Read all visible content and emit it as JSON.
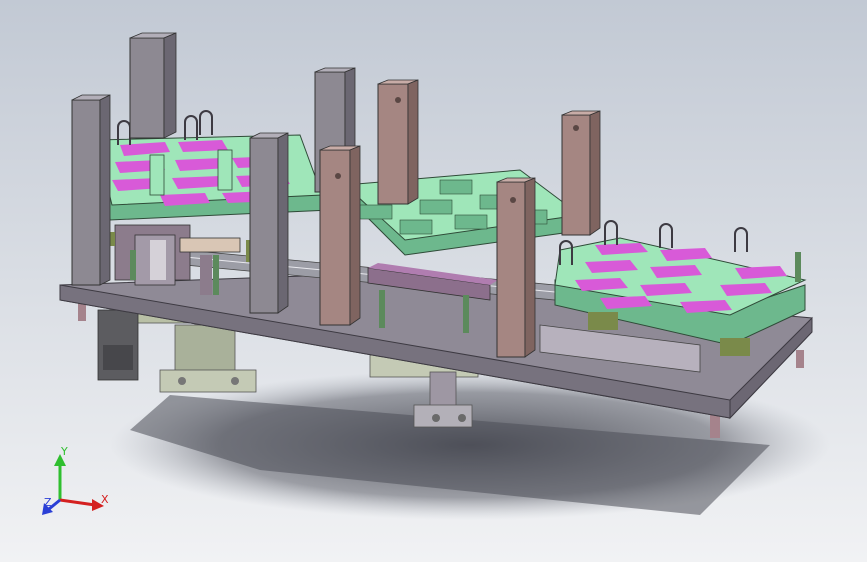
{
  "viewport": {
    "background_top": "#c2c9d4",
    "background_bottom": "#f1f2f4"
  },
  "model": {
    "colors": {
      "plate": "#8f8a96",
      "plate_dark": "#6f6a76",
      "post": "#a58682",
      "post_dark": "#7f6460",
      "post_gray": "#8d8992",
      "green": "#9fe6b9",
      "green_dark": "#6db88d",
      "magenta": "#d85ad8",
      "magenta_dark": "#a43aa8",
      "olive": "#7a8a4a",
      "mechanism": "#8c7c8c",
      "motor": "#5f5f63",
      "shadow": "#4a4c55"
    }
  },
  "triad": {
    "x_label": "X",
    "y_label": "Y",
    "z_label": "Z",
    "x_color": "#d42020",
    "y_color": "#2fbf2f",
    "z_color": "#2a3fd6"
  }
}
